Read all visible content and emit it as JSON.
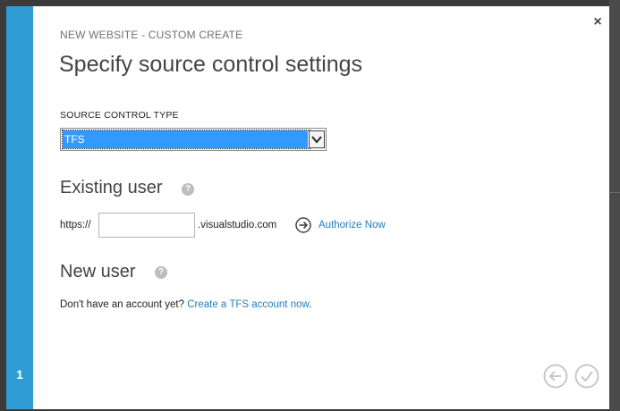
{
  "dialog": {
    "step_number": "1",
    "subtitle": "NEW WEBSITE - CUSTOM CREATE",
    "title": "Specify source control settings",
    "close_label": "×"
  },
  "source_control": {
    "label": "SOURCE CONTROL TYPE",
    "selected_value": "TFS"
  },
  "existing_user": {
    "heading": "Existing user",
    "help_glyph": "?",
    "url_prefix": "https://",
    "url_value": "",
    "url_suffix": ".visualstudio.com",
    "authorize_label": "Authorize Now"
  },
  "new_user": {
    "heading": "New user",
    "help_glyph": "?",
    "prompt_text": "Don't have an account yet?",
    "create_link": "Create a TFS account now",
    "trailing_period": "."
  },
  "colors": {
    "accent": "#2f9cd6",
    "link": "#1f7fc0",
    "selection": "#3399ff",
    "nav_disabled": "#c8c8c8"
  },
  "icons": {
    "close": "close-icon",
    "help": "question-circle-icon",
    "authorize": "arrow-right-circle-icon",
    "back": "arrow-left-circle-icon",
    "finish": "checkmark-circle-icon",
    "dropdown": "chevron-down-icon"
  }
}
